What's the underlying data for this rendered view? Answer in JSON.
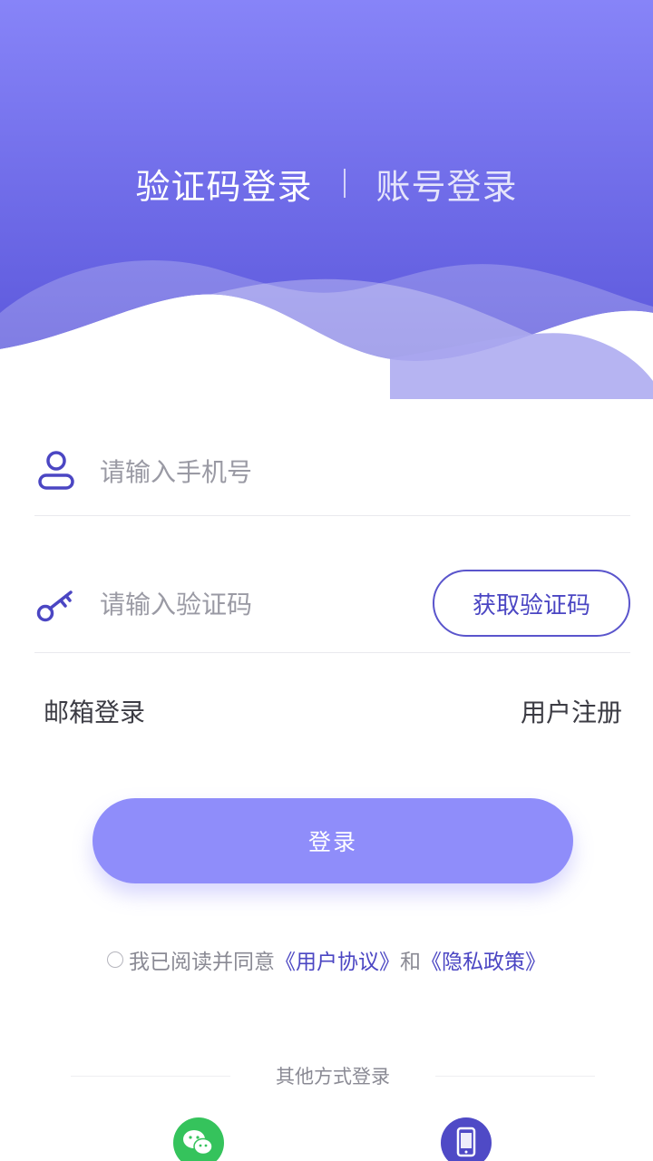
{
  "tabs": {
    "sms_login": "验证码登录",
    "account_login": "账号登录"
  },
  "form": {
    "phone_placeholder": "请输入手机号",
    "code_placeholder": "请输入验证码",
    "get_code_label": "获取验证码"
  },
  "links": {
    "email_login": "邮箱登录",
    "register": "用户注册"
  },
  "login_button": "登录",
  "agreement": {
    "prefix": "我已阅读并同意",
    "user_agreement": "《用户协议》",
    "and": "和",
    "privacy_policy": "《隐私政策》"
  },
  "other_login": {
    "label": "其他方式登录",
    "options": [
      "wechat-icon",
      "phone-icon"
    ]
  },
  "colors": {
    "gradient_top": "#8481f7",
    "gradient_bottom": "#5753d8",
    "accent": "#4b46c3",
    "button": "#8f8dfa",
    "wechat": "#35c35c"
  }
}
